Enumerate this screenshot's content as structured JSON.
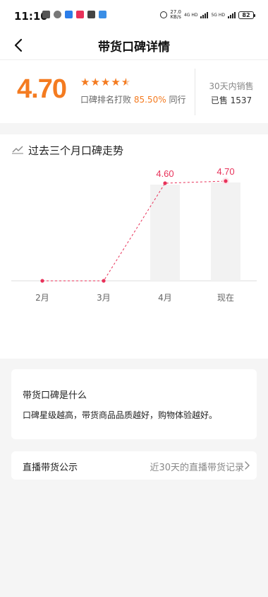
{
  "status_bar": {
    "time": "11:10",
    "net_speed_value": "27.0",
    "net_speed_unit": "KB/s",
    "net1": "4G HD",
    "net2": "5G HD",
    "battery": "82"
  },
  "nav": {
    "title": "带货口碑详情"
  },
  "rating": {
    "score": "4.70",
    "stars": 4.7,
    "rank_prefix": "口碑排名打败",
    "rank_percent": "85.50%",
    "rank_suffix": "同行",
    "sales_label": "30天内销售",
    "sales_value": "已售 1537"
  },
  "trend": {
    "title": "过去三个月口碑走势"
  },
  "chart_data": {
    "type": "line",
    "categories": [
      "2月",
      "3月",
      "4月",
      "现在"
    ],
    "values": [
      null,
      null,
      4.6,
      4.7
    ],
    "data_labels": [
      "",
      "",
      "4.60",
      "4.70"
    ],
    "ylim": [
      0,
      5
    ],
    "grid": false,
    "colors": {
      "line": "#e8325a",
      "bar": "#f2f2f2",
      "axis": "#dddddd"
    }
  },
  "info": {
    "title": "带货口碑是什么",
    "description": "口碑星级越高，带货商品品质越好，购物体验越好。"
  },
  "live_link": {
    "label": "直播带货公示",
    "link_text": "近30天的直播带货记录"
  },
  "colors": {
    "accent": "#f47b20",
    "chart_red": "#e8325a"
  }
}
